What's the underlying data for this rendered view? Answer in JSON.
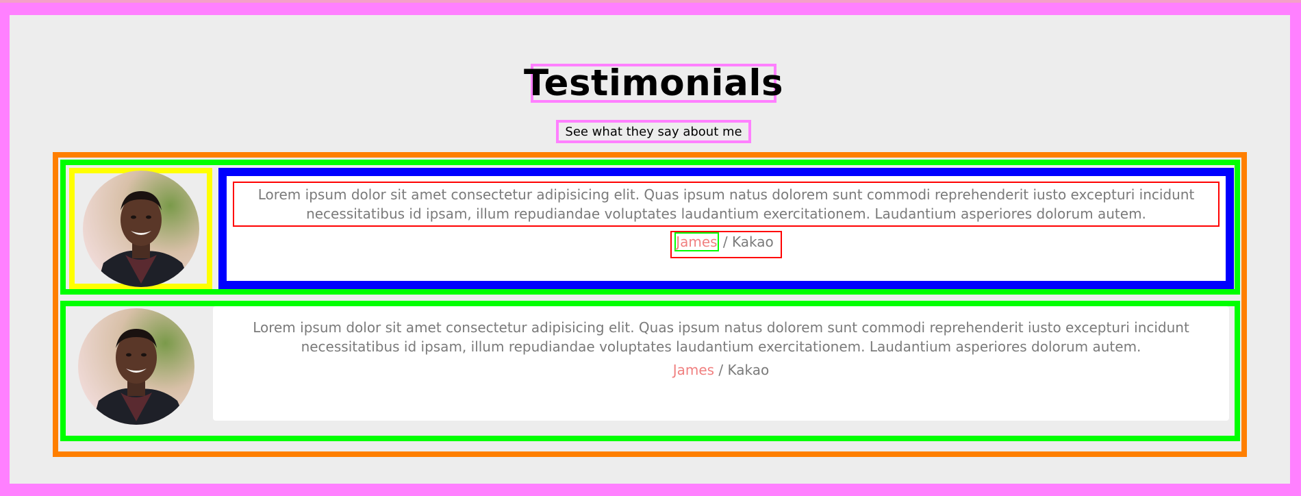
{
  "header": {
    "title": "Testimonials",
    "subtitle": "See what they say about me"
  },
  "testimonials": [
    {
      "quote": "Lorem ipsum dolor sit amet consectetur adipisicing elit. Quas ipsum natus dolorem sunt commodi reprehenderit iusto excepturi incidunt necessitatibus id ipsam, illum repudiandae voluptates laudantium exercitationem. Laudantium asperiores dolorum autem.",
      "name": "James",
      "separator": " / ",
      "company": "Kakao"
    },
    {
      "quote": "Lorem ipsum dolor sit amet consectetur adipisicing elit. Quas ipsum natus dolorem sunt commodi reprehenderit iusto excepturi incidunt necessitatibus id ipsam, illum repudiandae voluptates laudantium exercitationem. Laudantium asperiores dolorum autem.",
      "name": "James",
      "separator": " / ",
      "company": "Kakao"
    }
  ],
  "colors": {
    "outer_background": "#ff80ff",
    "page_background": "#ededed",
    "list_border": "#ff7f00",
    "item_border": "#00ff00",
    "photo_border": "#ffff00",
    "card_border": "#0000ff",
    "text_highlight_border": "#ff0000",
    "name_color": "#f08080",
    "text_color": "#7a7a7a"
  }
}
